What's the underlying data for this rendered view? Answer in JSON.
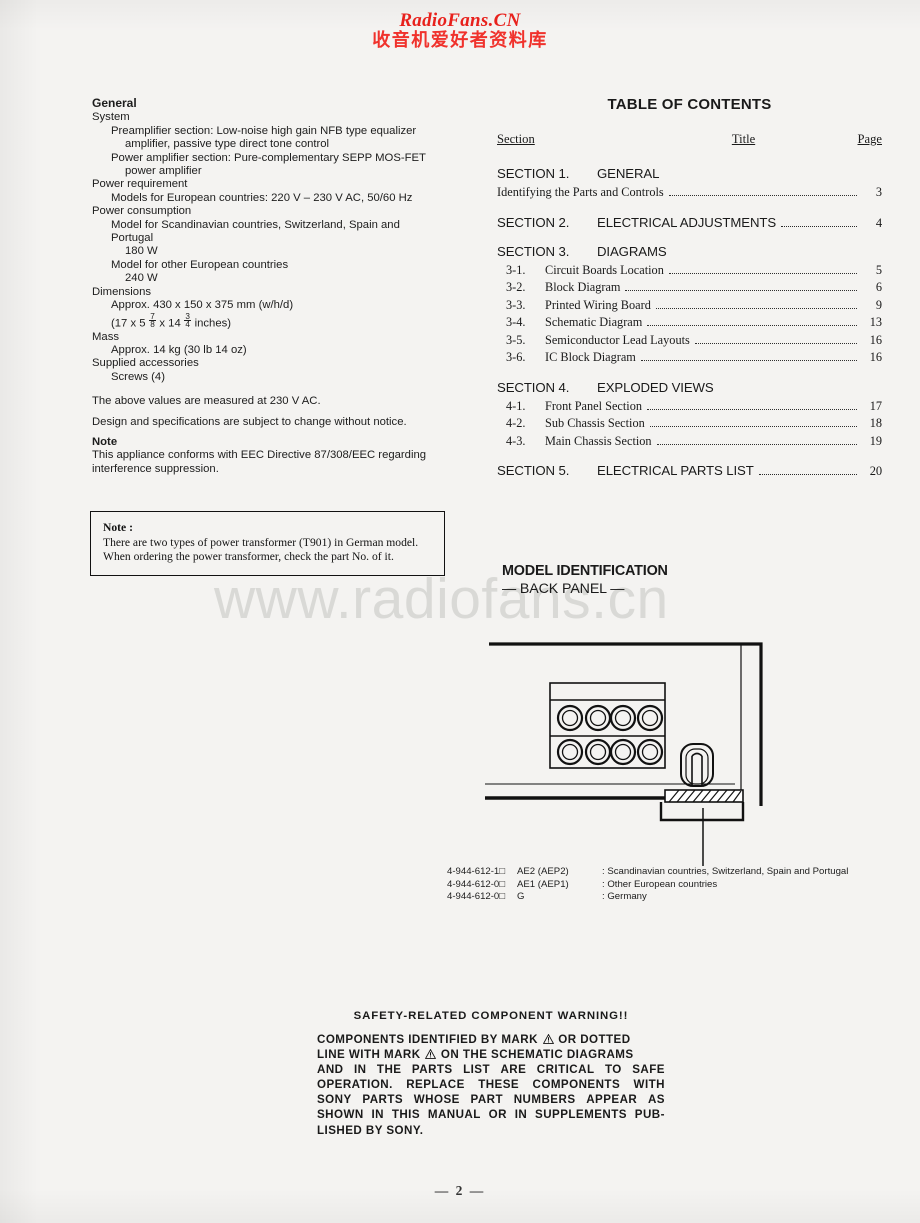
{
  "watermark": {
    "top_en": "RadioFans.CN",
    "top_cn": "收音机爱好者资料库",
    "big": "www.radiofans.cn",
    "color_red": "#e8211c",
    "color_gray": "#d9d9d6"
  },
  "specifications": {
    "heading": "General",
    "lines": [
      {
        "indent": 0,
        "text": "System"
      },
      {
        "indent": 1,
        "text": "Preamplifier section: Low-noise high gain NFB type equalizer"
      },
      {
        "indent": 2,
        "text": "amplifier, passive type direct tone  control"
      },
      {
        "indent": 1,
        "text": "Power amplifier section: Pure-complementary SEPP MOS-FET"
      },
      {
        "indent": 2,
        "text": "power amplifier"
      },
      {
        "indent": 0,
        "text": "Power requirement"
      },
      {
        "indent": 1,
        "text": "Models for European countries: 220 V – 230 V AC, 50/60 Hz"
      },
      {
        "indent": 0,
        "text": "Power consumption"
      },
      {
        "indent": 1,
        "text": "Model for Scandinavian countries, Switzerland, Spain and"
      },
      {
        "indent": 1,
        "text": "Portugal"
      },
      {
        "indent": 2,
        "text": "180 W"
      },
      {
        "indent": 1,
        "text": "Model for other European countries"
      },
      {
        "indent": 2,
        "text": "240 W"
      },
      {
        "indent": 0,
        "text": "Dimensions"
      },
      {
        "indent": 1,
        "text": "Approx. 430 x 150 x 375 mm (w/h/d)"
      },
      {
        "indent": 0,
        "text": "Mass"
      },
      {
        "indent": 1,
        "text": "Approx. 14 kg (30 lb 14 oz)"
      },
      {
        "indent": 0,
        "text": "Supplied accessories"
      },
      {
        "indent": 1,
        "text": "Screws (4)"
      }
    ],
    "dimensions_inches": {
      "prefix": "(17 x  5 ",
      "frac1_num": "7",
      "frac1_den": "8",
      "middle": " x 14 ",
      "frac2_num": "3",
      "frac2_den": "4",
      "suffix": " inches)"
    },
    "measured_note": "The above values are measured at 230 V AC.",
    "change_note": "Design and specifications are subject to change without notice.",
    "note_heading": "Note",
    "note_text_1": "This appliance conforms with EEC Directive 87/308/EEC regarding",
    "note_text_2": "interference suppression."
  },
  "transformer_note": {
    "heading": "Note :",
    "line1": "There are two types of power transformer (T901) in German model.",
    "line2": "When ordering the power transformer, check the part No. of it."
  },
  "toc": {
    "title": "TABLE OF CONTENTS",
    "columns": {
      "section": "Section",
      "title": "Title",
      "page": "Page"
    },
    "sections": [
      {
        "number": "SECTION 1.",
        "name": "GENERAL",
        "page": "",
        "entries": [
          {
            "num": "",
            "title": "Identifying the Parts and Controls",
            "page": "3"
          }
        ]
      },
      {
        "number": "SECTION 2.",
        "name": "ELECTRICAL ADJUSTMENTS",
        "page": "4",
        "entries": []
      },
      {
        "number": "SECTION 3.",
        "name": "DIAGRAMS",
        "page": "",
        "entries": [
          {
            "num": "3-1.",
            "title": "Circuit Boards Location",
            "page": "5"
          },
          {
            "num": "3-2.",
            "title": "Block Diagram",
            "page": "6"
          },
          {
            "num": "3-3.",
            "title": "Printed Wiring Board",
            "page": "9"
          },
          {
            "num": "3-4.",
            "title": "Schematic Diagram",
            "page": "13"
          },
          {
            "num": "3-5.",
            "title": "Semiconductor Lead Layouts",
            "page": "16"
          },
          {
            "num": "3-6.",
            "title": "IC Block Diagram",
            "page": "16"
          }
        ]
      },
      {
        "number": "SECTION 4.",
        "name": "EXPLODED VIEWS",
        "page": "",
        "entries": [
          {
            "num": "4-1.",
            "title": "Front Panel Section",
            "page": "17"
          },
          {
            "num": "4-2.",
            "title": "Sub Chassis Section",
            "page": "18"
          },
          {
            "num": "4-3.",
            "title": "Main Chassis Section",
            "page": "19"
          }
        ]
      },
      {
        "number": "SECTION 5.",
        "name": "ELECTRICAL PARTS LIST",
        "page": "20",
        "entries": []
      }
    ]
  },
  "model_identification": {
    "title": "MODEL IDENTIFICATION",
    "subtitle": "— BACK PANEL —",
    "models": [
      {
        "code": "4-944-612-1□",
        "name": "AE2 (AEP2)",
        "desc": ": Scandinavian countries, Switzerland, Spain and Portugal"
      },
      {
        "code": "4-944-612-0□",
        "name": "AE1 (AEP1)",
        "desc": ": Other European countries"
      },
      {
        "code": "4-944-612-0□",
        "name": "G",
        "desc": ": Germany"
      }
    ]
  },
  "safety_warning": {
    "title": "SAFETY-RELATED COMPONENT WARNING!!",
    "lines": [
      {
        "before": "COMPONENTS IDENTIFIED BY MARK ",
        "triangle": true,
        "after": " OR DOTTED",
        "justify": false
      },
      {
        "before": "LINE WITH MARK ",
        "triangle": true,
        "after": " ON THE SCHEMATIC DIAGRAMS",
        "justify": false
      },
      {
        "before": "AND IN THE PARTS LIST ARE CRITICAL TO SAFE",
        "triangle": false,
        "after": "",
        "justify": true
      },
      {
        "before": "OPERATION.   REPLACE THESE COMPONENTS WITH",
        "triangle": false,
        "after": "",
        "justify": true
      },
      {
        "before": "SONY PARTS WHOSE PART NUMBERS APPEAR AS",
        "triangle": false,
        "after": "",
        "justify": true
      },
      {
        "before": "SHOWN IN THIS MANUAL OR IN SUPPLEMENTS PUB-",
        "triangle": false,
        "after": "",
        "justify": true
      },
      {
        "before": "LISHED BY SONY.",
        "triangle": false,
        "after": "",
        "justify": false
      }
    ]
  },
  "footer": {
    "page_number": "— 2 —"
  }
}
